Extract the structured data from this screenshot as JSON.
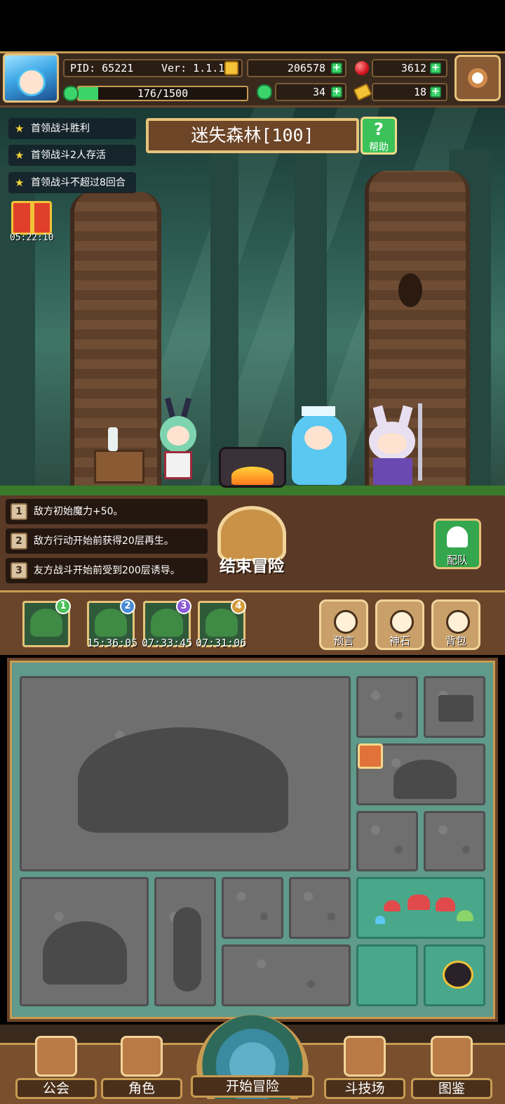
{
  "header": {
    "pid": "PID: 65221",
    "version": "Ver: 1.1.1.4",
    "gold": "206578",
    "ruby": "3612",
    "energy": "176/1500",
    "energy_fraction": 0.117,
    "clover": "34",
    "keys": "18"
  },
  "objectives": [
    "首领战斗胜利",
    "首领战斗2人存活",
    "首领战斗不超过8回合"
  ],
  "stage": {
    "title": "迷失森林[100]",
    "help_label": "帮助"
  },
  "gift_timer": "05:22:10",
  "buffs": [
    {
      "num": "1",
      "text": "敌方初始魔力+50。"
    },
    {
      "num": "2",
      "text": "敌方行动开始前获得20层再生。"
    },
    {
      "num": "3",
      "text": "友方战斗开始前受到200层诱导。"
    }
  ],
  "end_adventure_label": "结束冒险",
  "team_label": "配队",
  "slots": [
    {
      "num": "1",
      "timer": "",
      "color": "#4cbf5a"
    },
    {
      "num": "2",
      "timer": "15:36:05",
      "color": "#4a8ad4"
    },
    {
      "num": "3",
      "timer": "07:33:45",
      "color": "#8a5ad4"
    },
    {
      "num": "4",
      "timer": "07:31:06",
      "color": "#d49a3a"
    }
  ],
  "actions": [
    {
      "label": "预言",
      "icon": "crystal-ball-icon"
    },
    {
      "label": "神石",
      "icon": "stone-icon"
    },
    {
      "label": "背包",
      "icon": "bag-icon"
    }
  ],
  "nav": {
    "guild": "公会",
    "character": "角色",
    "start": "开始冒险",
    "arena": "斗技场",
    "codex": "图鉴"
  }
}
